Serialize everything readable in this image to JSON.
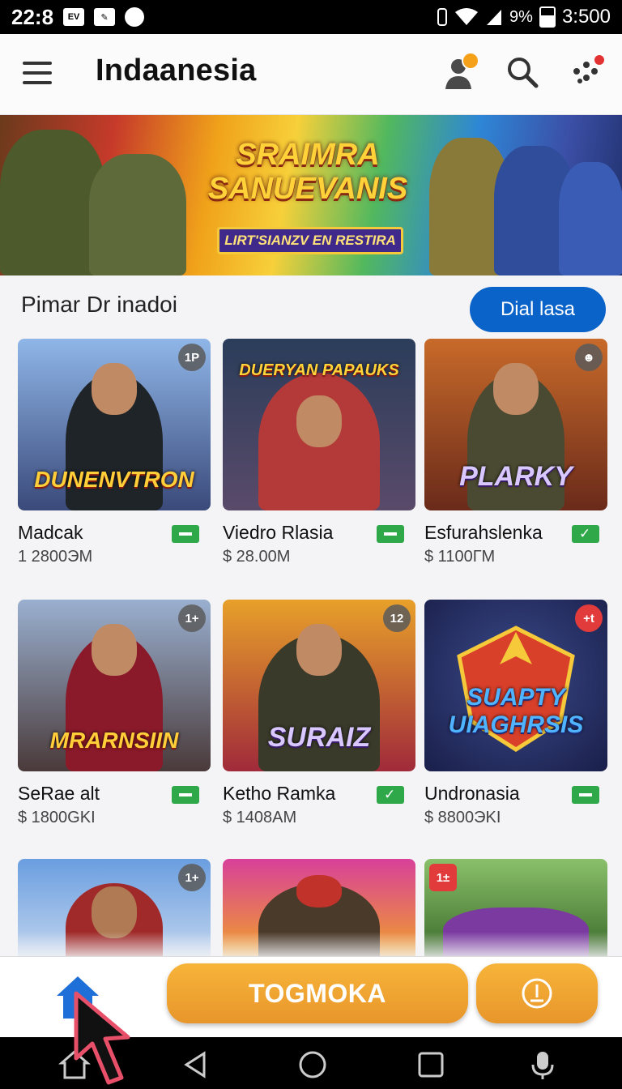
{
  "status_bar": {
    "time_left": "22:8",
    "battery_percent": "9%",
    "clock": "3:500"
  },
  "header": {
    "title": "Indaanesia",
    "icons": [
      "menu-icon",
      "user-icon",
      "search-icon",
      "apps-icon"
    ]
  },
  "banner": {
    "title_line1": "SRAIMRA",
    "title_line2": "SANUEVANIS",
    "subtitle": "LIRT'SIANZV EN RESTIRA"
  },
  "section": {
    "title": "Pimar Dr inadoi",
    "button_label": "Dial lasa"
  },
  "games": [
    {
      "name": "Madcak",
      "price": "1  2800ЭM",
      "badge": "1P",
      "logo": "DUNENVTRON",
      "tag": "minus"
    },
    {
      "name": "Viedro Rlasia",
      "price": "$  28.00M",
      "badge": "",
      "logo": "DUERYAN PAPAUKS",
      "tag": "minus"
    },
    {
      "name": "Esfurahslenka",
      "price": "$  1100ГM",
      "badge": "☻",
      "logo": "PLARKY",
      "tag": "check"
    },
    {
      "name": "SeRae alt",
      "price": "$  1800GKI",
      "badge": "1+",
      "logo": "MRARNSIIN",
      "tag": "minus"
    },
    {
      "name": "Ketho Ramka",
      "price": "$  1408AM",
      "badge": "12",
      "logo": "SURAIZ",
      "tag": "check"
    },
    {
      "name": "Undronasia",
      "price": "$  8800ЭKI",
      "badge": "+t",
      "logo": "SUAPTY UIAGHRSIS",
      "tag": "minus"
    },
    {
      "name": "",
      "price": "",
      "badge": "1+",
      "logo": "",
      "tag": ""
    },
    {
      "name": "",
      "price": "",
      "badge": "",
      "logo": "",
      "tag": ""
    },
    {
      "name": "",
      "price": "",
      "badge": "1±",
      "logo": "",
      "tag": ""
    }
  ],
  "bottom_bar": {
    "primary_label": "TOGMOKA",
    "home_icon": "home-icon",
    "secondary_icon": "download-icon"
  },
  "nav_bar": {
    "icons": [
      "home-outline-icon",
      "back-icon",
      "home-circle-icon",
      "recents-icon",
      "mic-icon"
    ]
  },
  "colors": {
    "accent_blue": "#0a63c9",
    "accent_orange": "#f0a52e",
    "tag_green": "#2fa84a"
  }
}
